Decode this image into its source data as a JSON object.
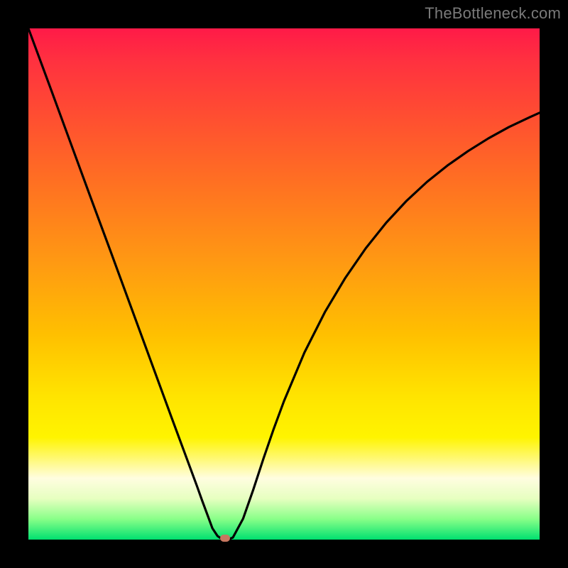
{
  "watermark": "TheBottleneck.com",
  "chart_data": {
    "type": "line",
    "title": "",
    "xlabel": "",
    "ylabel": "",
    "xlim": [
      0,
      100
    ],
    "ylim": [
      0,
      100
    ],
    "x": [
      0,
      4,
      8,
      12,
      16,
      20,
      24,
      28,
      30,
      32,
      33,
      34,
      35,
      36,
      37,
      38,
      39,
      40,
      42,
      44,
      46,
      48,
      50,
      54,
      58,
      62,
      66,
      70,
      74,
      78,
      82,
      86,
      90,
      94,
      98,
      100
    ],
    "values": [
      100,
      89.2,
      78.3,
      67.4,
      56.6,
      45.7,
      34.8,
      23.9,
      18.5,
      13.1,
      10.4,
      7.6,
      4.9,
      2.2,
      0.7,
      0.0,
      0.0,
      0.4,
      4.1,
      9.8,
      15.9,
      21.7,
      27.1,
      36.6,
      44.5,
      51.2,
      57.0,
      62.0,
      66.3,
      70.0,
      73.2,
      76.0,
      78.5,
      80.7,
      82.6,
      83.5
    ],
    "background_gradient": {
      "orientation": "vertical",
      "top_color": "#ff1a48",
      "mid_color": "#ffe400",
      "bottom_color": "#00e070"
    },
    "marker": {
      "x_percent": 38.5,
      "y_percent": 0,
      "color": "#c77760"
    },
    "frame_color": "#000000",
    "curve_color": "#000000"
  }
}
